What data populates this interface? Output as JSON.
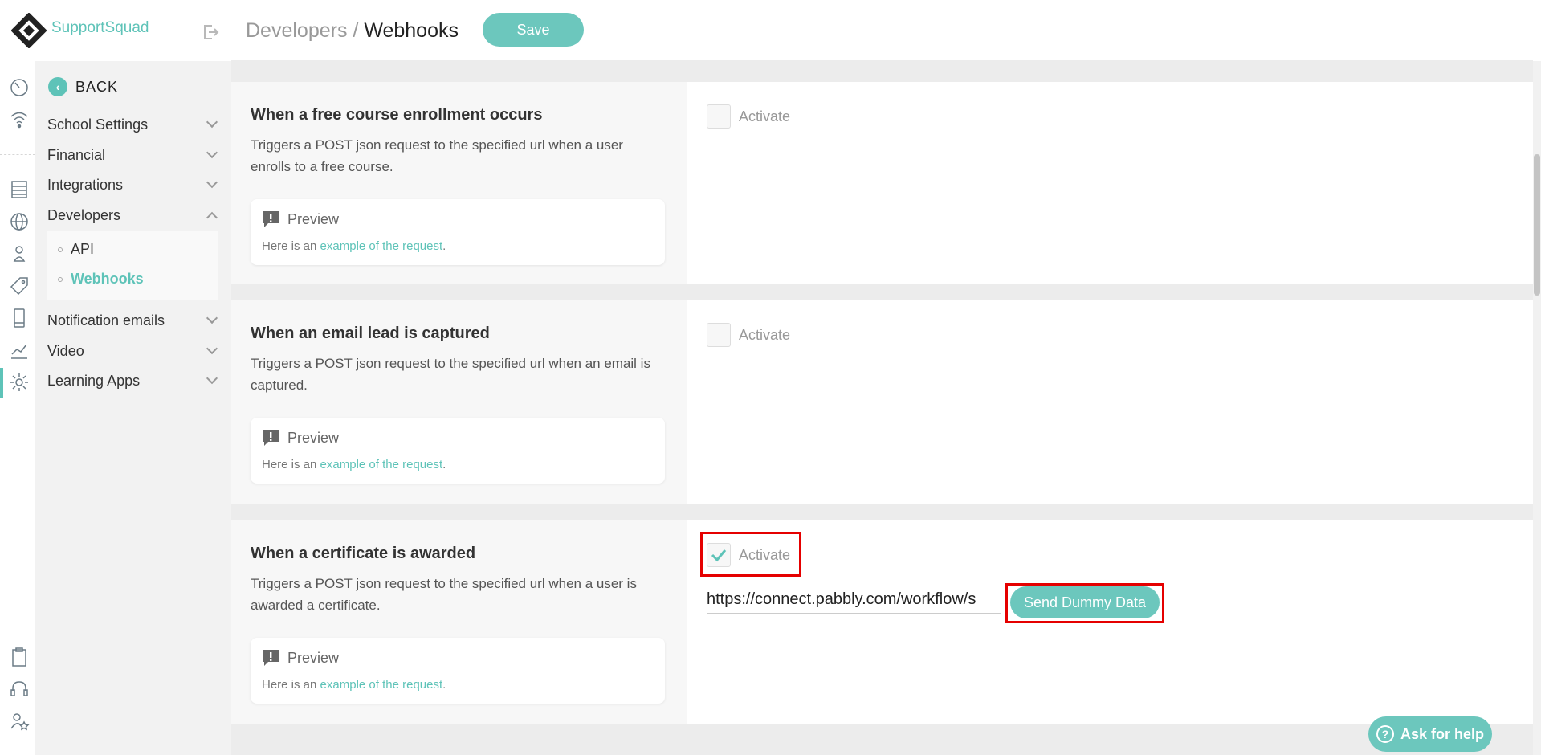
{
  "app": {
    "brand": "SupportSquad"
  },
  "sidebar": {
    "back_label": "BACK",
    "items": [
      {
        "label": "School Settings"
      },
      {
        "label": "Financial"
      },
      {
        "label": "Integrations"
      },
      {
        "label": "Developers"
      },
      {
        "label": "Notification emails"
      },
      {
        "label": "Video"
      },
      {
        "label": "Learning Apps"
      }
    ],
    "developers_sub": [
      {
        "label": "API"
      },
      {
        "label": "Webhooks"
      }
    ]
  },
  "header": {
    "breadcrumb_parent": "Developers /",
    "breadcrumb_current": "Webhooks",
    "save_label": "Save"
  },
  "sections": [
    {
      "title": "When a free course enrollment occurs",
      "description": "Triggers a POST json request to the specified url when a user enrolls to a free course.",
      "preview_title": "Preview",
      "preview_prefix": "Here is an",
      "preview_link": "example of the request",
      "preview_suffix": ".",
      "activate_label": "Activate",
      "checked": false
    },
    {
      "title": "When an email lead is captured",
      "description": "Triggers a POST json request to the specified url when an email is captured.",
      "preview_title": "Preview",
      "preview_prefix": "Here is an",
      "preview_link": "example of the request",
      "preview_suffix": ".",
      "activate_label": "Activate",
      "checked": false
    },
    {
      "title": "When a certificate is awarded",
      "description": "Triggers a POST json request to the specified url when a user is awarded a certificate.",
      "preview_title": "Preview",
      "preview_prefix": "Here is an",
      "preview_link": "example of the request",
      "preview_suffix": ".",
      "activate_label": "Activate",
      "checked": true,
      "url_value": "https://connect.pabbly.com/workflow/s",
      "send_label": "Send Dummy Data"
    }
  ],
  "help": {
    "label": "Ask for help"
  },
  "colors": {
    "accent": "#5ec3b8",
    "highlight": "#e50000"
  }
}
